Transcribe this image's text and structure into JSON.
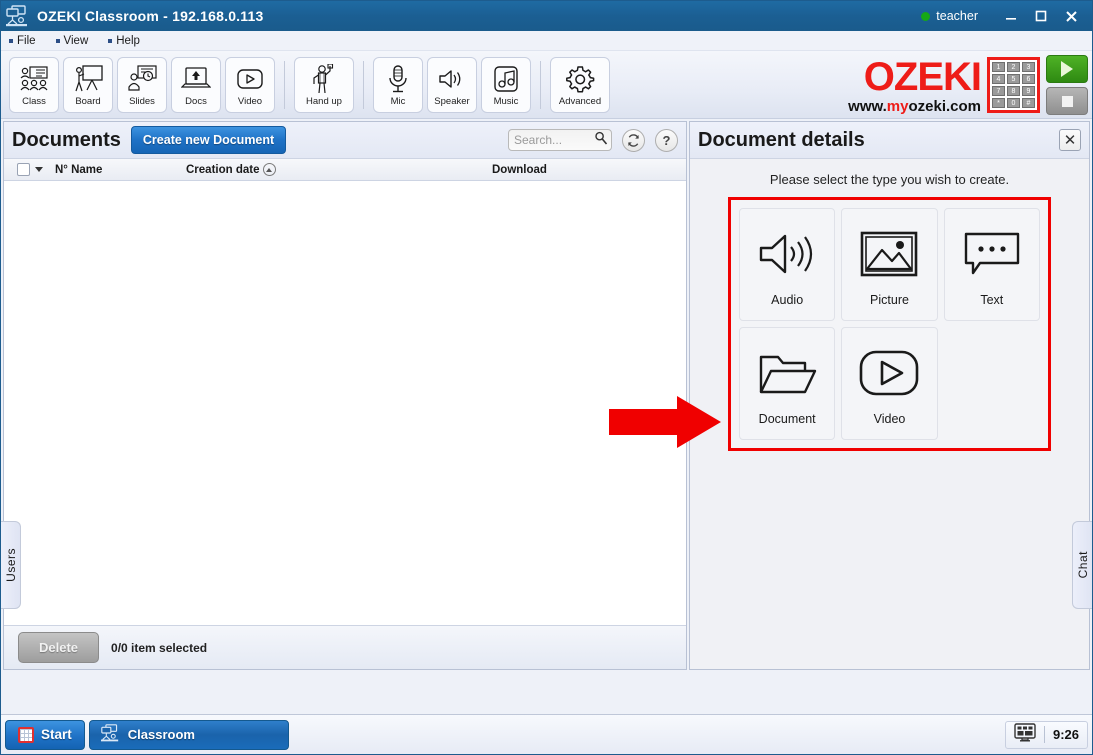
{
  "titlebar": {
    "app_icon": "classroom-icon",
    "title": "OZEKI Classroom",
    "separator": "-",
    "address": "192.168.0.113",
    "user": "teacher",
    "status_color": "#16a816",
    "minimize": "_",
    "maximize": "☐",
    "close": "✕"
  },
  "menubar": {
    "items": [
      {
        "label": "File"
      },
      {
        "label": "View"
      },
      {
        "label": "Help"
      }
    ]
  },
  "toolbar": {
    "groups": [
      {
        "buttons": [
          {
            "label": "Class",
            "icon": "class-icon"
          },
          {
            "label": "Board",
            "icon": "board-icon"
          },
          {
            "label": "Slides",
            "icon": "slides-icon"
          },
          {
            "label": "Docs",
            "icon": "docs-icon"
          },
          {
            "label": "Video",
            "icon": "video-icon"
          }
        ]
      },
      {
        "buttons": [
          {
            "label": "Hand up",
            "icon": "hand-up-icon"
          }
        ]
      },
      {
        "buttons": [
          {
            "label": "Mic",
            "icon": "mic-icon"
          },
          {
            "label": "Speaker",
            "icon": "speaker-icon"
          },
          {
            "label": "Music",
            "icon": "music-icon"
          }
        ]
      },
      {
        "buttons": [
          {
            "label": "Advanced",
            "icon": "gear-icon"
          }
        ]
      }
    ]
  },
  "logo": {
    "brand": "OZEKI",
    "url_prefix": "www.",
    "url_accent": "my",
    "url_suffix": "ozeki.com",
    "brand_color": "#ee1c18",
    "keypad_keys": [
      "1",
      "2",
      "3",
      "4",
      "5",
      "6",
      "7",
      "8",
      "9",
      "*",
      "0",
      "#"
    ],
    "play_button": "play-icon",
    "stop_button": "stop-icon"
  },
  "side_tabs": {
    "left": "Users",
    "right": "Chat"
  },
  "left_panel": {
    "title": "Documents",
    "create_button": "Create new Document",
    "search": {
      "placeholder": "Search...",
      "value": ""
    },
    "refresh_icon": "refresh-icon",
    "help_icon": "help-icon",
    "columns": {
      "number_name": "N° Name",
      "creation_date": "Creation date",
      "download": "Download"
    },
    "rows": [],
    "footer": {
      "delete_button": "Delete",
      "selection_text": "0/0 item selected"
    }
  },
  "right_panel": {
    "title": "Document details",
    "close_icon": "✕",
    "prompt": "Please select the type you wish to create.",
    "types": [
      {
        "label": "Audio",
        "icon": "audio-icon"
      },
      {
        "label": "Picture",
        "icon": "picture-icon"
      },
      {
        "label": "Text",
        "icon": "text-bubble-icon"
      },
      {
        "label": "Document",
        "icon": "folder-icon"
      },
      {
        "label": "Video",
        "icon": "video-play-icon"
      }
    ],
    "highlight_color": "#f00000"
  },
  "annotation": {
    "arrow": "red-arrow-right",
    "color": "#f00000"
  },
  "taskbar": {
    "start_label": "Start",
    "items": [
      {
        "label": "Classroom",
        "icon": "classroom-icon"
      }
    ],
    "tray_icon": "display-icon",
    "clock": "9:26"
  }
}
